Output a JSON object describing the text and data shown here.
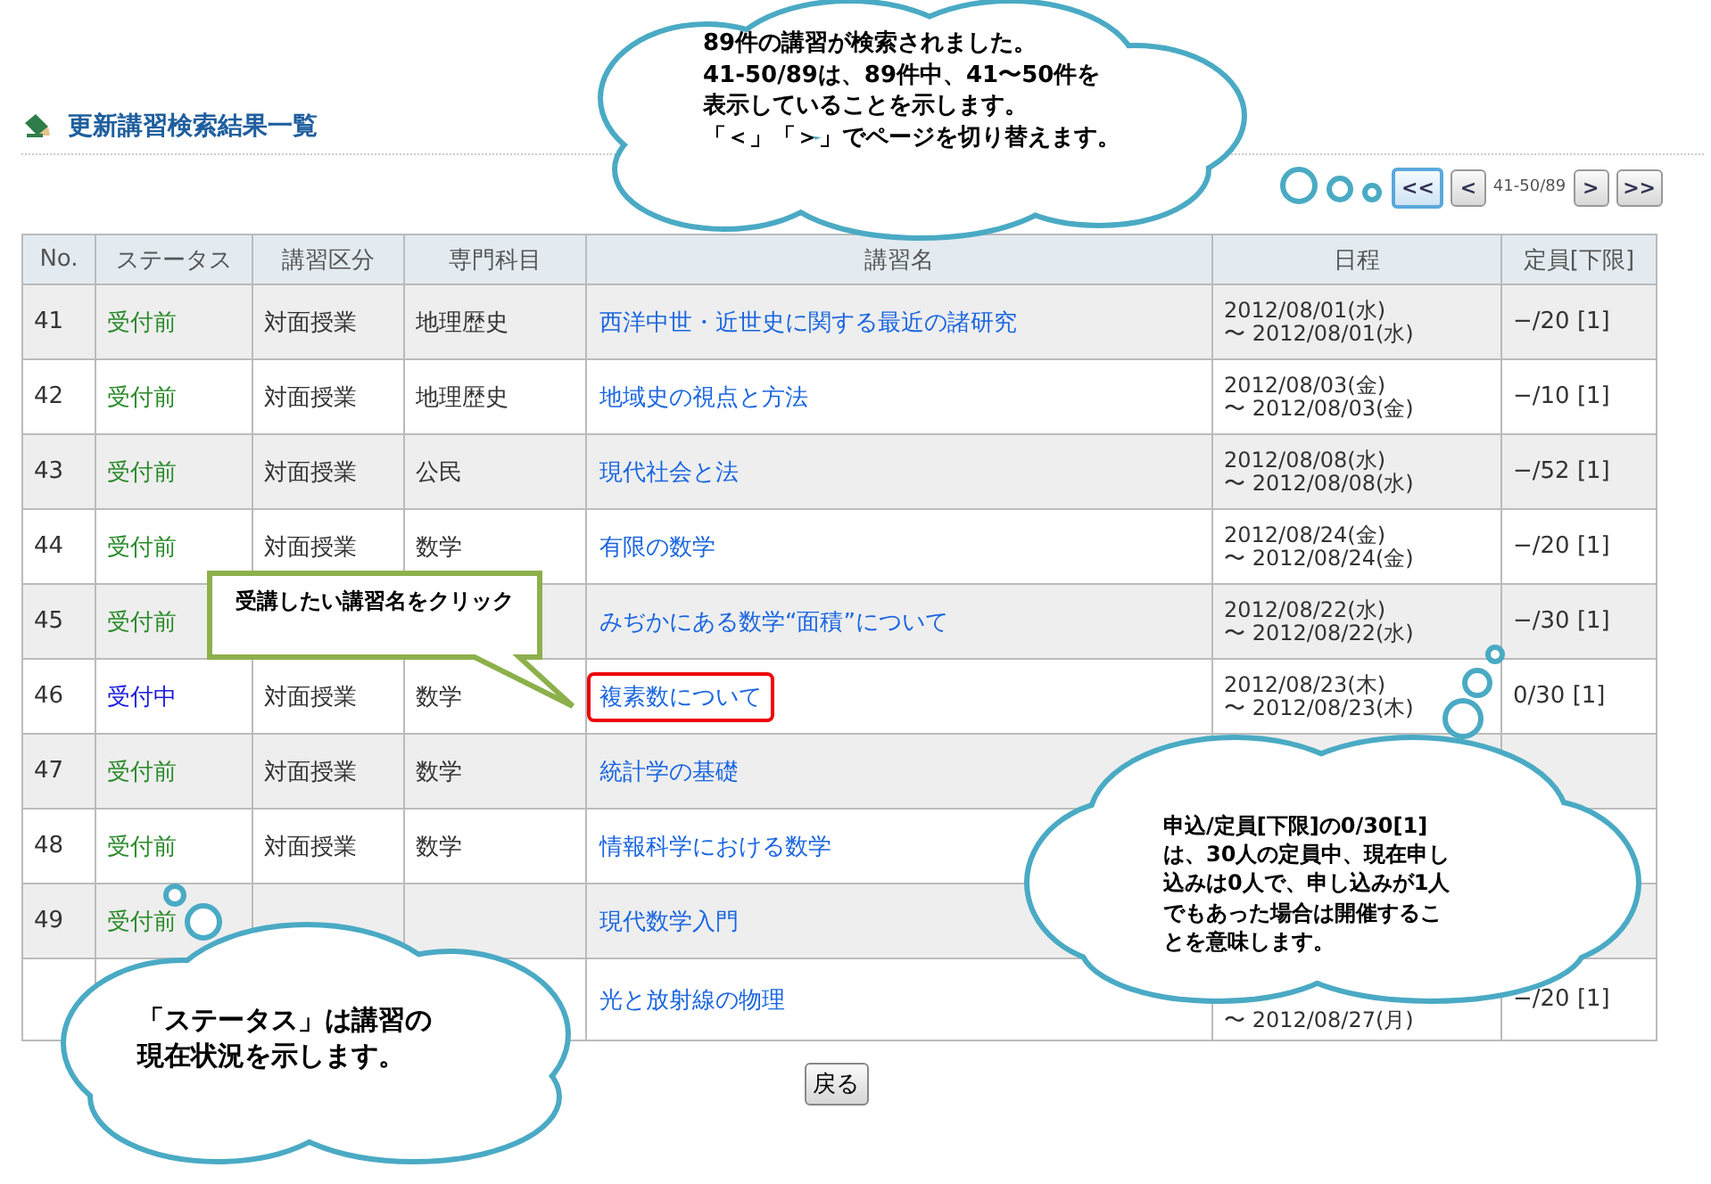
{
  "page": {
    "title": "更新講習検索結果一覧"
  },
  "pager": {
    "before": [
      {
        "label": "<<",
        "highlighted": true
      },
      {
        "label": "<",
        "highlighted": false
      }
    ],
    "range": "41-50/89",
    "after": [
      {
        "label": ">",
        "highlighted": false
      },
      {
        "label": ">>",
        "highlighted": false
      }
    ]
  },
  "table": {
    "columns": [
      "No.",
      "ステータス",
      "講習区分",
      "専門科目",
      "講習名",
      "日程",
      "定員[下限]"
    ],
    "rows": [
      {
        "no": "41",
        "status": {
          "text": "受付前",
          "color": "#2a8a2a"
        },
        "type": "対面授業",
        "subject": "地理歴史",
        "name": "西洋中世・近世史に関する最近の諸研究",
        "highlighted": false,
        "date": [
          "2012/08/01(水)",
          "〜 2012/08/01(水)"
        ],
        "capacity": "−/20 [1]"
      },
      {
        "no": "42",
        "status": {
          "text": "受付前",
          "color": "#2a8a2a"
        },
        "type": "対面授業",
        "subject": "地理歴史",
        "name": "地域史の視点と方法",
        "highlighted": false,
        "date": [
          "2012/08/03(金)",
          "〜 2012/08/03(金)"
        ],
        "capacity": "−/10 [1]"
      },
      {
        "no": "43",
        "status": {
          "text": "受付前",
          "color": "#2a8a2a"
        },
        "type": "対面授業",
        "subject": "公民",
        "name": "現代社会と法",
        "highlighted": false,
        "date": [
          "2012/08/08(水)",
          "〜 2012/08/08(水)"
        ],
        "capacity": "−/52 [1]"
      },
      {
        "no": "44",
        "status": {
          "text": "受付前",
          "color": "#2a8a2a"
        },
        "type": "対面授業",
        "subject": "数学",
        "name": "有限の数学",
        "highlighted": false,
        "date": [
          "2012/08/24(金)",
          "〜 2012/08/24(金)"
        ],
        "capacity": "−/20 [1]"
      },
      {
        "no": "45",
        "status": {
          "text": "受付前",
          "color": "#2a8a2a"
        },
        "name": "みぢかにある数学“面積”について",
        "highlighted": false,
        "date": [
          "2012/08/22(水)",
          "〜 2012/08/22(水)"
        ],
        "capacity": "−/30 [1]"
      },
      {
        "no": "46",
        "status": {
          "text": "受付中",
          "color": "#1a1ae0"
        },
        "type": "対面授業",
        "subject": "数学",
        "name": "複素数について",
        "highlighted": true,
        "date": [
          "2012/08/23(木)",
          "〜 2012/08/23(木)"
        ],
        "capacity": "0/30 [1]"
      },
      {
        "no": "47",
        "status": {
          "text": "受付前",
          "color": "#2a8a2a"
        },
        "type": "対面授業",
        "subject": "数学",
        "name": "統計学の基礎",
        "highlighted": false
      },
      {
        "no": "48",
        "status": {
          "text": "受付前",
          "color": "#2a8a2a"
        },
        "type": "対面授業",
        "subject": "数学",
        "name": "情報科学における数学",
        "highlighted": false
      },
      {
        "no": "49",
        "status": {
          "text": "受付前",
          "color": "#2a8a2a"
        },
        "name": "現代数学入門",
        "highlighted": false
      },
      {
        "name": "光と放射線の物理",
        "highlighted": false,
        "date": [
          "〜 2012/08/27(月)"
        ],
        "capacity": "−/20 [1]"
      }
    ]
  },
  "back_button": "戻る",
  "annotations": [
    {
      "kind": "cloud",
      "lines": [
        "89件の講習が検索されました。",
        "41-50/89は、89件中、41〜50件を",
        "表示していることを示します。",
        "「＜」「＞」でページを切り替えます。"
      ]
    },
    {
      "kind": "box",
      "lines": [
        "受講したい講習名をクリック"
      ]
    },
    {
      "kind": "cloud",
      "lines": [
        "申込/定員[下限]の0/30[1]",
        "は、30人の定員中、現在申し",
        "込みは0人で、申し込みが1人",
        "でもあった場合は開催するこ",
        "とを意味します。"
      ]
    },
    {
      "kind": "cloud",
      "lines": [
        "「ステータス」は講習の",
        "現在状況を示します。"
      ]
    }
  ]
}
